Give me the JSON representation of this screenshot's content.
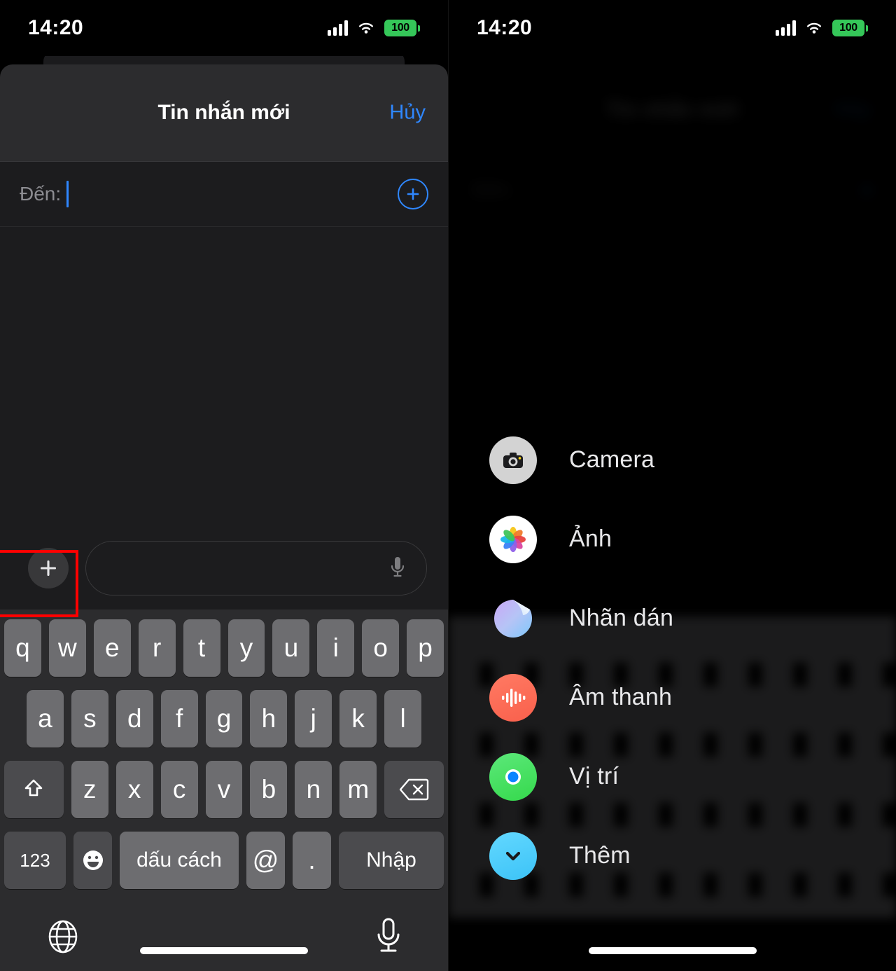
{
  "status_bar": {
    "time": "14:20",
    "battery_percent": "100",
    "icons": {
      "cellular": "cellular-signal-icon",
      "wifi": "wifi-icon",
      "battery": "battery-icon"
    }
  },
  "colors": {
    "accent_blue": "#2f87ff",
    "battery_green": "#35c759",
    "highlight_red": "#ff0000",
    "sheet_bg": "#1c1c1e",
    "sheet_header_bg": "#2c2c2e",
    "keyboard_bg": "#2c2c2e",
    "key_light": "#6d6d70",
    "key_dark": "#4b4b4e"
  },
  "left_panel": {
    "sheet": {
      "title": "Tin nhắn mới",
      "cancel_label": "Hủy"
    },
    "recipient_field": {
      "label": "Đến:",
      "value": "",
      "placeholder": "",
      "add_contact_icon": "plus-circle-icon"
    },
    "compose_bar": {
      "plus_icon": "plus-icon",
      "input_value": "",
      "input_placeholder": "",
      "mic_icon": "microphone-icon"
    },
    "keyboard": {
      "row1": [
        "q",
        "w",
        "e",
        "r",
        "t",
        "y",
        "u",
        "i",
        "o",
        "p"
      ],
      "row2": [
        "a",
        "s",
        "d",
        "f",
        "g",
        "h",
        "j",
        "k",
        "l"
      ],
      "row3": [
        "z",
        "x",
        "c",
        "v",
        "b",
        "n",
        "m"
      ],
      "shift_icon": "shift-up-arrow-icon",
      "backspace_icon": "backspace-delete-icon",
      "numbers_label": "123",
      "emoji_icon": "emoji-smiley-icon",
      "space_label": "dấu cách",
      "at_label": "@",
      "period_label": ".",
      "enter_label": "Nhập",
      "globe_icon": "globe-language-icon",
      "dictation_icon": "microphone-icon"
    },
    "highlight": {
      "target": "compose-plus-button",
      "color": "#ff0000"
    }
  },
  "right_panel": {
    "menu": {
      "items": [
        {
          "label": "Camera",
          "icon": "camera-icon"
        },
        {
          "label": "Ảnh",
          "icon": "photos-icon"
        },
        {
          "label": "Nhãn dán",
          "icon": "sticker-icon"
        },
        {
          "label": "Âm thanh",
          "icon": "audio-waveform-icon"
        },
        {
          "label": "Vị trí",
          "icon": "location-icon"
        },
        {
          "label": "Thêm",
          "icon": "more-chevron-down-icon"
        }
      ]
    },
    "highlight": {
      "target": "menu-item-them",
      "color": "#ff0000"
    }
  }
}
